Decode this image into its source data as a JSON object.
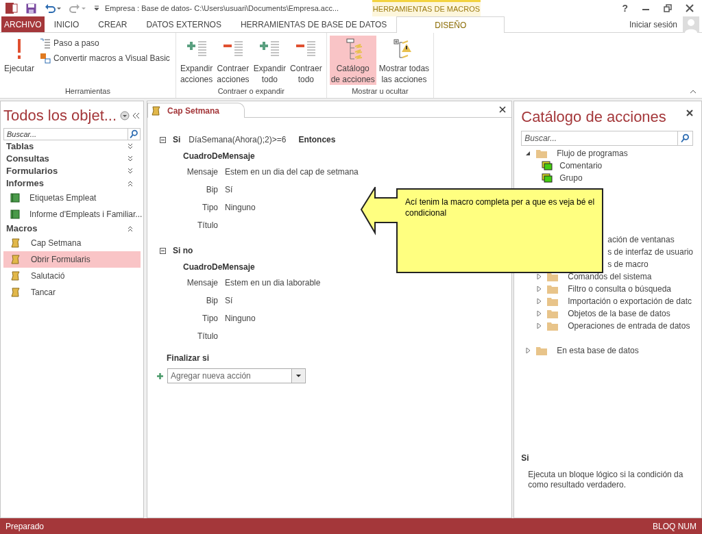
{
  "title_bar": {
    "title": "Empresa : Base de datos- C:\\Users\\usuari\\Documents\\Empresa.acc...",
    "context_group": "HERRAMIENTAS DE MACROS",
    "help": "?"
  },
  "ribbon_tabs": [
    {
      "label": "ARCHIVO",
      "kind": "file",
      "selected": false
    },
    {
      "label": "INICIO",
      "kind": "tab",
      "selected": false
    },
    {
      "label": "CREAR",
      "kind": "tab",
      "selected": false
    },
    {
      "label": "DATOS EXTERNOS",
      "kind": "tab",
      "selected": false
    },
    {
      "label": "HERRAMIENTAS DE BASE DE DATOS",
      "kind": "tab",
      "selected": false
    },
    {
      "label": "DISEÑO",
      "kind": "context",
      "selected": true
    }
  ],
  "sign_in": "Iniciar sesión",
  "ribbon_groups": [
    {
      "label": "Herramientas",
      "buttons": [
        {
          "lines": [
            "Ejecutar"
          ],
          "kind": "run",
          "selected": false
        },
        {
          "lines": [
            "Paso a paso"
          ],
          "kind": "step",
          "selected": false
        },
        {
          "lines": [
            "Convertir macros a Visual Basic"
          ],
          "kind": "convert",
          "selected": false
        }
      ]
    },
    {
      "label": "Contraer o expandir",
      "buttons": [
        {
          "lines": [
            "Expandir",
            "acciones"
          ],
          "kind": "expand",
          "selected": false
        },
        {
          "lines": [
            "Contraer",
            "acciones"
          ],
          "kind": "collapse",
          "selected": false
        },
        {
          "lines": [
            "Expandir",
            "todo"
          ],
          "kind": "expand",
          "selected": false
        },
        {
          "lines": [
            "Contraer",
            "todo"
          ],
          "kind": "collapse",
          "selected": false
        }
      ]
    },
    {
      "label": "Mostrar u ocultar",
      "buttons": [
        {
          "lines": [
            "Catálogo",
            "de acciones"
          ],
          "kind": "catalog",
          "selected": true
        },
        {
          "lines": [
            "Mostrar todas",
            "las acciones"
          ],
          "kind": "showall",
          "selected": false
        }
      ]
    }
  ],
  "nav_pane": {
    "title": "Todos los objet...",
    "search_placeholder": "Buscar...",
    "groups": [
      {
        "label": "Tablas",
        "expanded": false
      },
      {
        "label": "Consultas",
        "expanded": false
      },
      {
        "label": "Formularios",
        "expanded": false
      },
      {
        "label": "Informes",
        "expanded": true,
        "items": [
          {
            "label": "Etiquetas Empleat",
            "kind": "report",
            "selected": false
          },
          {
            "label": "Informe d'Empleats i Familiar...",
            "kind": "report",
            "selected": false
          }
        ]
      },
      {
        "label": "Macros",
        "expanded": true,
        "items": [
          {
            "label": "Cap Setmana",
            "kind": "macro",
            "selected": false
          },
          {
            "label": "Obrir Formularis",
            "kind": "macro",
            "selected": true
          },
          {
            "label": "Salutació",
            "kind": "macro",
            "selected": false
          },
          {
            "label": "Tancar",
            "kind": "macro",
            "selected": false
          }
        ]
      }
    ]
  },
  "document_tab": {
    "label": "Cap Setmana"
  },
  "macro": {
    "blocks": [
      {
        "keyword": "Si",
        "condition": "DíaSemana(Ahora();2)>=6",
        "then": "Entonces",
        "expanded": true,
        "action": "CuadroDeMensaje",
        "params": [
          {
            "label": "Mensaje",
            "value": "Estem en un dia del cap de setmana"
          },
          {
            "label": "Bip",
            "value": "Sí"
          },
          {
            "label": "Tipo",
            "value": "Ninguno"
          },
          {
            "label": "Título"
          }
        ]
      },
      {
        "keyword": "Si no",
        "expanded": true,
        "action": "CuadroDeMensaje",
        "params": [
          {
            "label": "Mensaje",
            "value": "Estem en un dia laborable"
          },
          {
            "label": "Bip",
            "value": "Sí"
          },
          {
            "label": "Tipo",
            "value": "Ninguno"
          },
          {
            "label": "Título"
          }
        ]
      }
    ],
    "end": "Finalizar si",
    "add_action_placeholder": "Agregar nueva acción"
  },
  "callout": {
    "text": "Ací tenim la macro completa per a que es veja bé el condicional"
  },
  "catalog": {
    "title": "Catálogo de acciones",
    "search_placeholder": "Buscar...",
    "tree": [
      {
        "label": "Flujo de programas",
        "expanded": true,
        "children": [
          {
            "label": "Comentario",
            "kind": "action"
          },
          {
            "label": "Grupo",
            "kind": "action"
          }
        ]
      },
      {
        "label": "ación de ventanas",
        "kind": "covered"
      },
      {
        "label": "s de interfaz de usuario",
        "kind": "covered"
      },
      {
        "label": "s de macro",
        "kind": "covered"
      },
      {
        "label": "Comandos del sistema",
        "kind": "folder",
        "expanded": false
      },
      {
        "label": "Filtro o consulta o búsqueda",
        "kind": "folder",
        "expanded": false
      },
      {
        "label": "Importación o exportación de datc",
        "kind": "folder",
        "expanded": false
      },
      {
        "label": "Objetos de la base de datos",
        "kind": "folder",
        "expanded": false
      },
      {
        "label": "Operaciones de entrada de datos",
        "kind": "folder",
        "expanded": false
      }
    ],
    "other": {
      "label": "En esta base de datos",
      "expanded": false
    },
    "help_title": "Si",
    "help_text": "Ejecuta un bloque lógico si la condición da como resultado verdadero."
  },
  "status_bar": {
    "left": "Preparado",
    "right": "BLOQ NUM"
  }
}
